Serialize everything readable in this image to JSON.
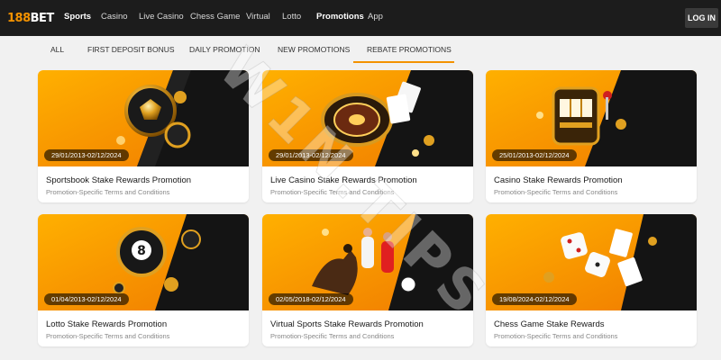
{
  "brand": {
    "logo_number": "188",
    "logo_text": "BET",
    "accent": "#f39200"
  },
  "nav": {
    "items": [
      {
        "label": "Sports",
        "active": true
      },
      {
        "label": "Casino",
        "active": false
      },
      {
        "label": "Live Casino",
        "active": false
      },
      {
        "label": "Chess Game",
        "active": false
      },
      {
        "label": "Virtual",
        "active": false
      },
      {
        "label": "Lotto",
        "active": false
      },
      {
        "label": "Promotions",
        "active": true
      },
      {
        "label": "App",
        "active": false
      }
    ],
    "login_label": "LOG IN"
  },
  "tabs": [
    {
      "label": "ALL"
    },
    {
      "label": "FIRST DEPOSIT BONUS"
    },
    {
      "label": "DAILY PROMOTION"
    },
    {
      "label": "NEW PROMOTIONS"
    },
    {
      "label": "REBATE PROMOTIONS",
      "selected": true
    }
  ],
  "promotions": [
    {
      "title": "Sportsbook Stake Rewards Promotion",
      "dates": "29/01/2013-02/12/2024",
      "terms": "Promotion-Specific Terms and Conditions",
      "icon": "soccer-ball-icon"
    },
    {
      "title": "Live Casino Stake Rewards Promotion",
      "dates": "29/01/2013-02/12/2024",
      "terms": "Promotion-Specific Terms and Conditions",
      "icon": "roulette-wheel-icon"
    },
    {
      "title": "Casino Stake Rewards Promotion",
      "dates": "25/01/2013-02/12/2024",
      "terms": "Promotion-Specific Terms and Conditions",
      "icon": "slot-machine-icon"
    },
    {
      "title": "Lotto Stake Rewards Promotion",
      "dates": "01/04/2013-02/12/2024",
      "terms": "Promotion-Specific Terms and Conditions",
      "icon": "lottery-ball-icon"
    },
    {
      "title": "Virtual Sports Stake Rewards Promotion",
      "dates": "02/05/2018-02/12/2024",
      "terms": "Promotion-Specific Terms and Conditions",
      "icon": "virtual-sports-icon"
    },
    {
      "title": "Chess Game Stake Rewards",
      "dates": "19/08/2024-02/12/2024",
      "terms": "Promotion-Specific Terms and Conditions",
      "icon": "dice-icon"
    }
  ],
  "watermark": "W1N.TIPS"
}
